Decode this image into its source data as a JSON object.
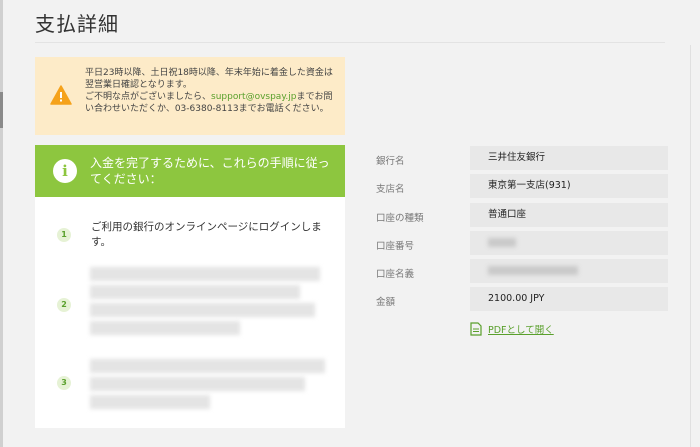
{
  "page": {
    "title": "支払詳細"
  },
  "warning": {
    "icon": "warning-icon",
    "line1": "平日23時以降、土日祝18時以降、年末年始に着金した資金は翌営業日確認となります。",
    "line2_pre": "ご不明な点がございましたら、",
    "email": "support@ovspay.jp",
    "line2_post": "までお問い合わせいただくか、03-6380-8113までお電話ください。"
  },
  "steps": {
    "header": "入金を完了するために、これらの手順に従ってください：",
    "items": [
      {
        "number": "1",
        "text": "ご利用の銀行のオンラインページにログインします。"
      },
      {
        "number": "2",
        "text": ""
      },
      {
        "number": "3",
        "text": ""
      }
    ]
  },
  "details": {
    "rows": [
      {
        "label": "銀行名",
        "value": "三井住友銀行"
      },
      {
        "label": "支店名",
        "value": "東京第一支店(931)"
      },
      {
        "label": "口座の種類",
        "value": "普通口座"
      },
      {
        "label": "口座番号",
        "value": ""
      },
      {
        "label": "口座名義",
        "value": ""
      },
      {
        "label": "金額",
        "value": "2100.00 JPY"
      }
    ],
    "pdf_link": "PDFとして開く"
  },
  "colors": {
    "accent_green": "#8dc63f",
    "link_green": "#5aa02c",
    "warning_bg": "#fdebc8",
    "warning_icon": "#f5a21b"
  }
}
